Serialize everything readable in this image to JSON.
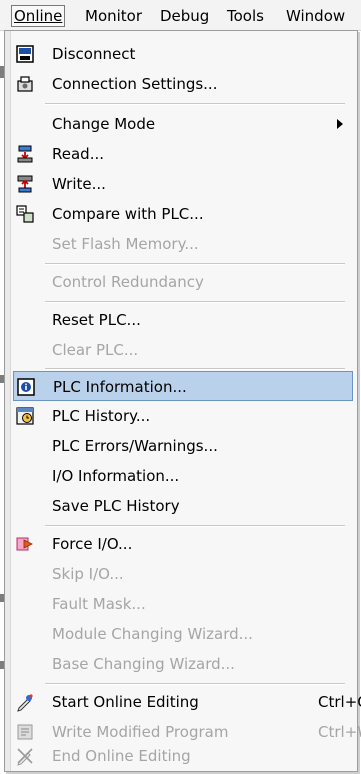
{
  "menubar": {
    "items": [
      {
        "label": "Online",
        "active": true
      },
      {
        "label": "Monitor",
        "active": false
      },
      {
        "label": "Debug",
        "active": false
      },
      {
        "label": "Tools",
        "active": false
      },
      {
        "label": "Window",
        "active": false
      }
    ]
  },
  "menu": {
    "disconnect": {
      "label": "Disconnect",
      "icon": "disconnect-icon"
    },
    "connection_settings": {
      "label": "Connection Settings...",
      "icon": "connection-settings-icon"
    },
    "change_mode": {
      "label": "Change Mode"
    },
    "read": {
      "label": "Read...",
      "icon": "read-icon"
    },
    "write": {
      "label": "Write...",
      "icon": "write-icon"
    },
    "compare": {
      "label": "Compare with PLC...",
      "icon": "compare-icon"
    },
    "set_flash": {
      "label": "Set Flash Memory...",
      "disabled": true
    },
    "control_redundancy": {
      "label": "Control Redundancy",
      "disabled": true
    },
    "reset_plc": {
      "label": "Reset PLC..."
    },
    "clear_plc": {
      "label": "Clear PLC...",
      "disabled": true
    },
    "plc_information": {
      "label": "PLC Information...",
      "icon": "plc-information-icon",
      "highlighted": true
    },
    "plc_history": {
      "label": "PLC History...",
      "icon": "plc-history-icon"
    },
    "plc_errors": {
      "label": "PLC Errors/Warnings..."
    },
    "io_information": {
      "label": "I/O Information..."
    },
    "save_plc_history": {
      "label": "Save PLC History"
    },
    "force_io": {
      "label": "Force I/O...",
      "icon": "force-io-icon"
    },
    "skip_io": {
      "label": "Skip I/O...",
      "disabled": true
    },
    "fault_mask": {
      "label": "Fault Mask...",
      "disabled": true
    },
    "module_changing": {
      "label": "Module Changing Wizard...",
      "disabled": true
    },
    "base_changing": {
      "label": "Base Changing Wizard...",
      "disabled": true
    },
    "start_online_editing": {
      "label": "Start Online Editing",
      "shortcut": "Ctrl+Q",
      "icon": "start-online-editing-icon"
    },
    "write_modified": {
      "label": "Write Modified Program",
      "shortcut": "Ctrl+W",
      "icon": "write-modified-icon",
      "disabled": true
    },
    "end_online_editing": {
      "label": "End Online Editing",
      "icon": "end-online-editing-icon",
      "disabled": true
    }
  },
  "colors": {
    "highlight": "#b9d1ea",
    "highlight_border": "#6c93c5",
    "disabled_text": "#a5a5a5"
  }
}
